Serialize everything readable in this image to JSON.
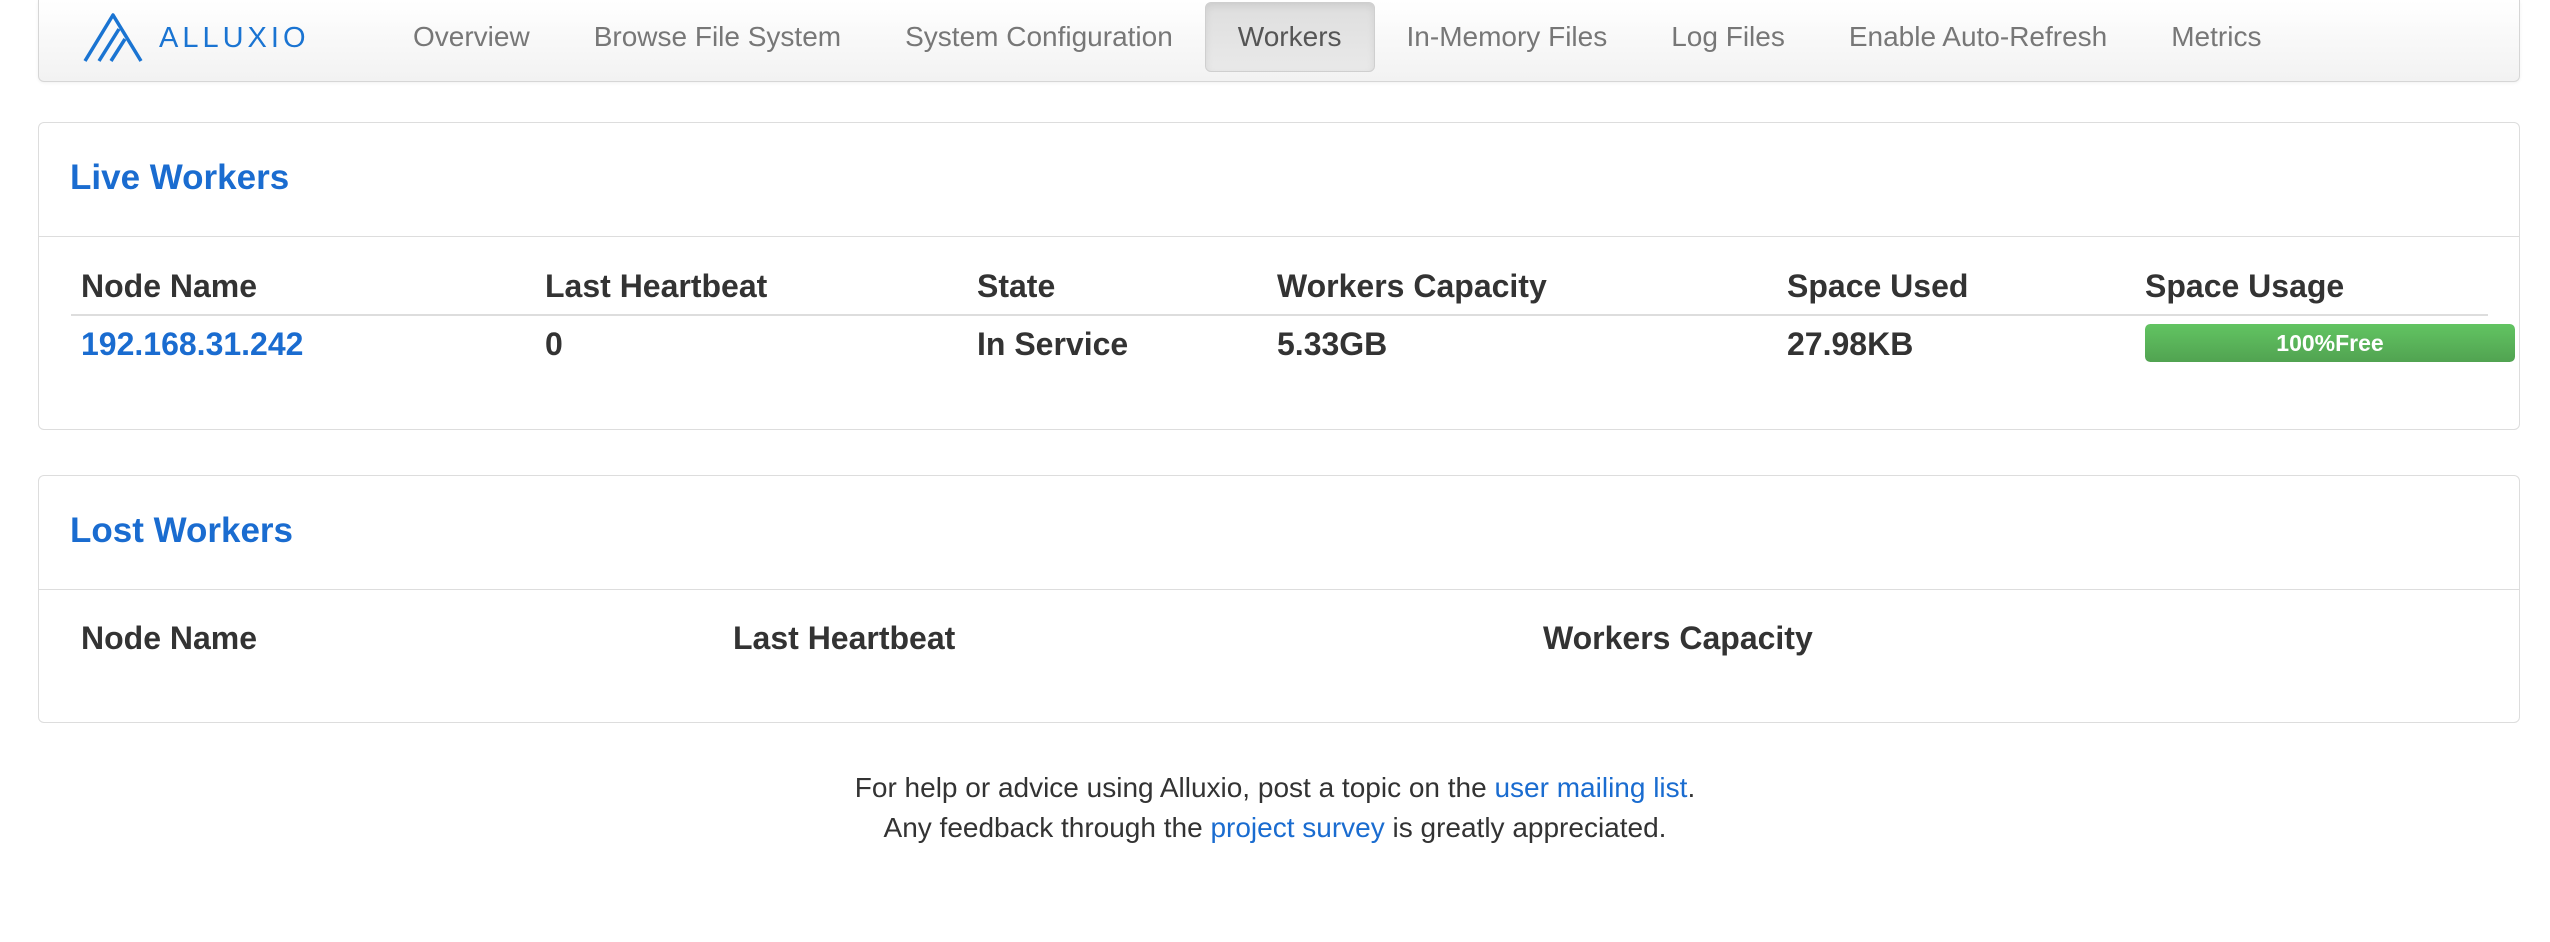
{
  "brand": {
    "name": "ALLUXIO",
    "logo_icon": "alluxio-logo-icon"
  },
  "nav": {
    "items": [
      {
        "label": "Overview"
      },
      {
        "label": "Browse File System"
      },
      {
        "label": "System Configuration"
      },
      {
        "label": "Workers",
        "active": true
      },
      {
        "label": "In-Memory Files"
      },
      {
        "label": "Log Files"
      },
      {
        "label": "Enable Auto-Refresh"
      },
      {
        "label": "Metrics"
      }
    ]
  },
  "live_workers": {
    "title": "Live Workers",
    "columns": [
      "Node Name",
      "Last Heartbeat",
      "State",
      "Workers Capacity",
      "Space Used",
      "Space Usage"
    ],
    "rows": [
      {
        "node_name": "192.168.31.242",
        "last_heartbeat": "0",
        "state": "In Service",
        "capacity": "5.33GB",
        "space_used": "27.98KB",
        "usage_label": "100%Free",
        "free_percent": 100
      }
    ]
  },
  "lost_workers": {
    "title": "Lost Workers",
    "columns": [
      "Node Name",
      "Last Heartbeat",
      "Workers Capacity"
    ]
  },
  "footer": {
    "line1_prefix": "For help or advice using Alluxio, post a topic on the ",
    "line1_link": "user mailing list",
    "line1_suffix": ".",
    "line2_prefix": "Any feedback through the ",
    "line2_link": "project survey",
    "line2_suffix": " is greatly appreciated."
  },
  "colors": {
    "accent": "#1a6cd0",
    "progress_green": "#5cb85c"
  }
}
